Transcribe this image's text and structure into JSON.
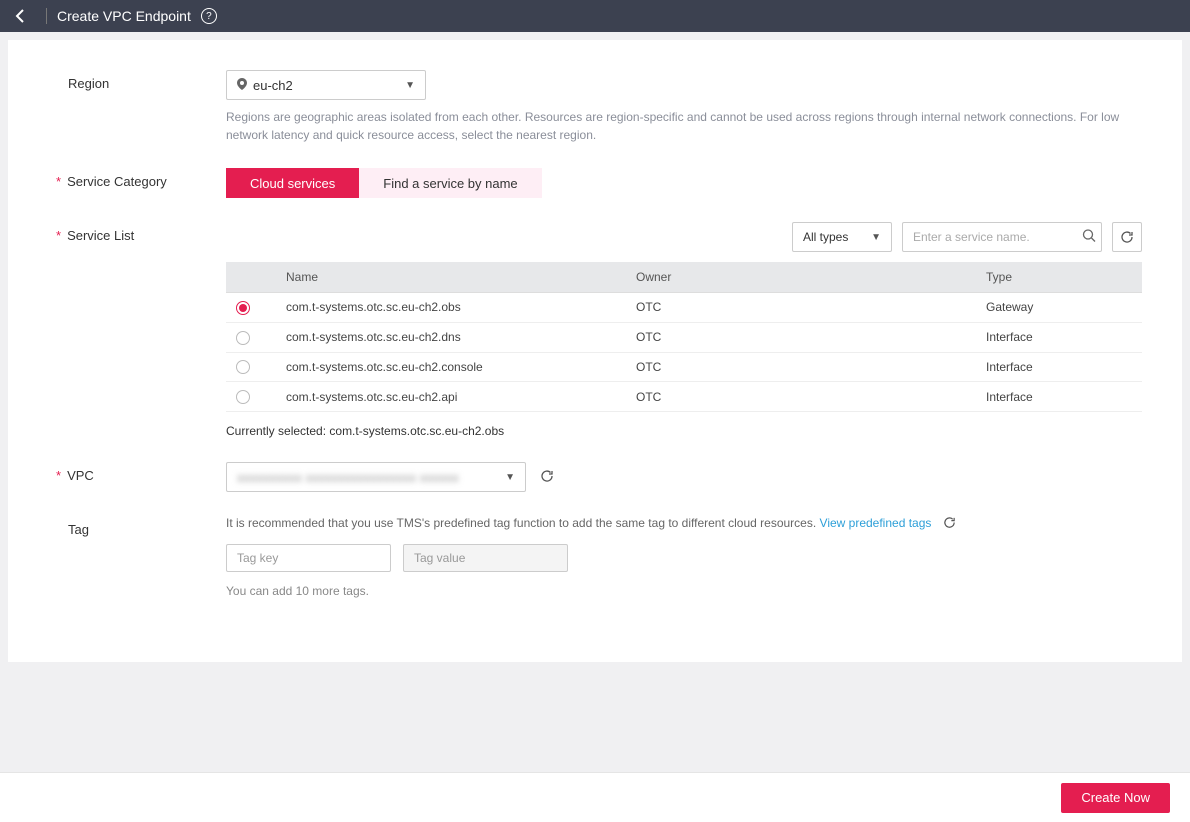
{
  "header": {
    "title": "Create VPC Endpoint"
  },
  "labels": {
    "region": "Region",
    "serviceCategory": "Service Category",
    "serviceList": "Service List",
    "vpc": "VPC",
    "tag": "Tag"
  },
  "region": {
    "selected": "eu-ch2",
    "help": "Regions are geographic areas isolated from each other. Resources are region-specific and cannot be used across regions through internal network connections. For low network latency and quick resource access, select the nearest region."
  },
  "serviceCategory": {
    "options": [
      "Cloud services",
      "Find a service by name"
    ],
    "active": 0
  },
  "serviceList": {
    "filterLabel": "All types",
    "searchPlaceholder": "Enter a service name.",
    "columns": {
      "name": "Name",
      "owner": "Owner",
      "type": "Type"
    },
    "rows": [
      {
        "name": "com.t-systems.otc.sc.eu-ch2.obs",
        "owner": "OTC",
        "type": "Gateway",
        "selected": true
      },
      {
        "name": "com.t-systems.otc.sc.eu-ch2.dns",
        "owner": "OTC",
        "type": "Interface",
        "selected": false
      },
      {
        "name": "com.t-systems.otc.sc.eu-ch2.console",
        "owner": "OTC",
        "type": "Interface",
        "selected": false
      },
      {
        "name": "com.t-systems.otc.sc.eu-ch2.api",
        "owner": "OTC",
        "type": "Interface",
        "selected": false
      }
    ],
    "currentlySelectedPrefix": "Currently selected: ",
    "currentlySelected": "com.t-systems.otc.sc.eu-ch2.obs"
  },
  "vpc": {
    "value": "xxxxxxxxxx xxxxxxxxxxxxxxxxx xxxxxx"
  },
  "tag": {
    "hint": "It is recommended that you use TMS's predefined tag function to add the same tag to different cloud resources. ",
    "link": "View predefined tags",
    "keyPlaceholder": "Tag key",
    "valuePlaceholder": "Tag value",
    "remaining": "You can add 10 more tags."
  },
  "footer": {
    "createLabel": "Create Now"
  }
}
